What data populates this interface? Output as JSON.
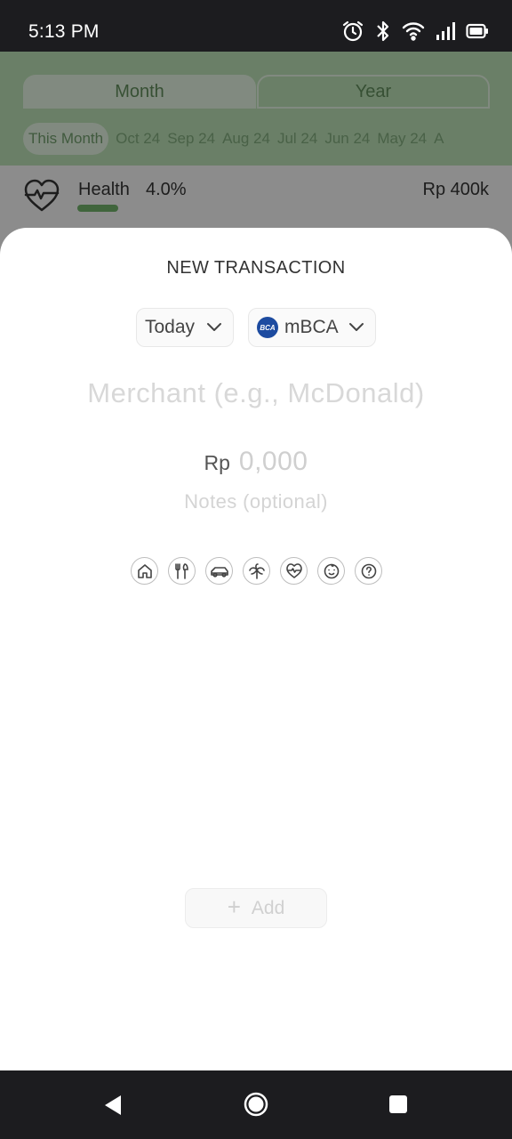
{
  "status_bar": {
    "time": "5:13 PM",
    "icons": [
      "alarm-icon",
      "bluetooth-icon",
      "wifi-icon",
      "signal-icon",
      "battery-icon"
    ]
  },
  "background": {
    "tabs": [
      {
        "label": "Month",
        "active": true
      },
      {
        "label": "Year",
        "active": false
      }
    ],
    "periods": [
      "This Month",
      "Oct 24",
      "Sep 24",
      "Aug 24",
      "Jul 24",
      "Jun 24",
      "May 24",
      "A"
    ],
    "active_period": "This Month",
    "category_row": {
      "icon": "heart-pulse-icon",
      "label": "Health",
      "percent": "4.0%",
      "amount": "Rp 400k"
    },
    "accent_color": "#6fae68"
  },
  "sheet": {
    "title": "NEW TRANSACTION",
    "date_chip": {
      "label": "Today"
    },
    "account_chip": {
      "logo_text": "BCA",
      "label": "mBCA"
    },
    "merchant_placeholder": "Merchant (e.g., McDonald)",
    "currency": "Rp",
    "amount_placeholder": "0,000",
    "notes_placeholder": "Notes (optional)",
    "categories": [
      "home-icon",
      "food-icon",
      "car-icon",
      "palm-tree-icon",
      "heart-pulse-icon",
      "baby-icon",
      "question-icon"
    ],
    "add_button": {
      "label": "Add",
      "icon": "plus-icon"
    }
  },
  "nav_bar": {
    "buttons": [
      "back-icon",
      "home-icon",
      "recents-icon"
    ]
  }
}
